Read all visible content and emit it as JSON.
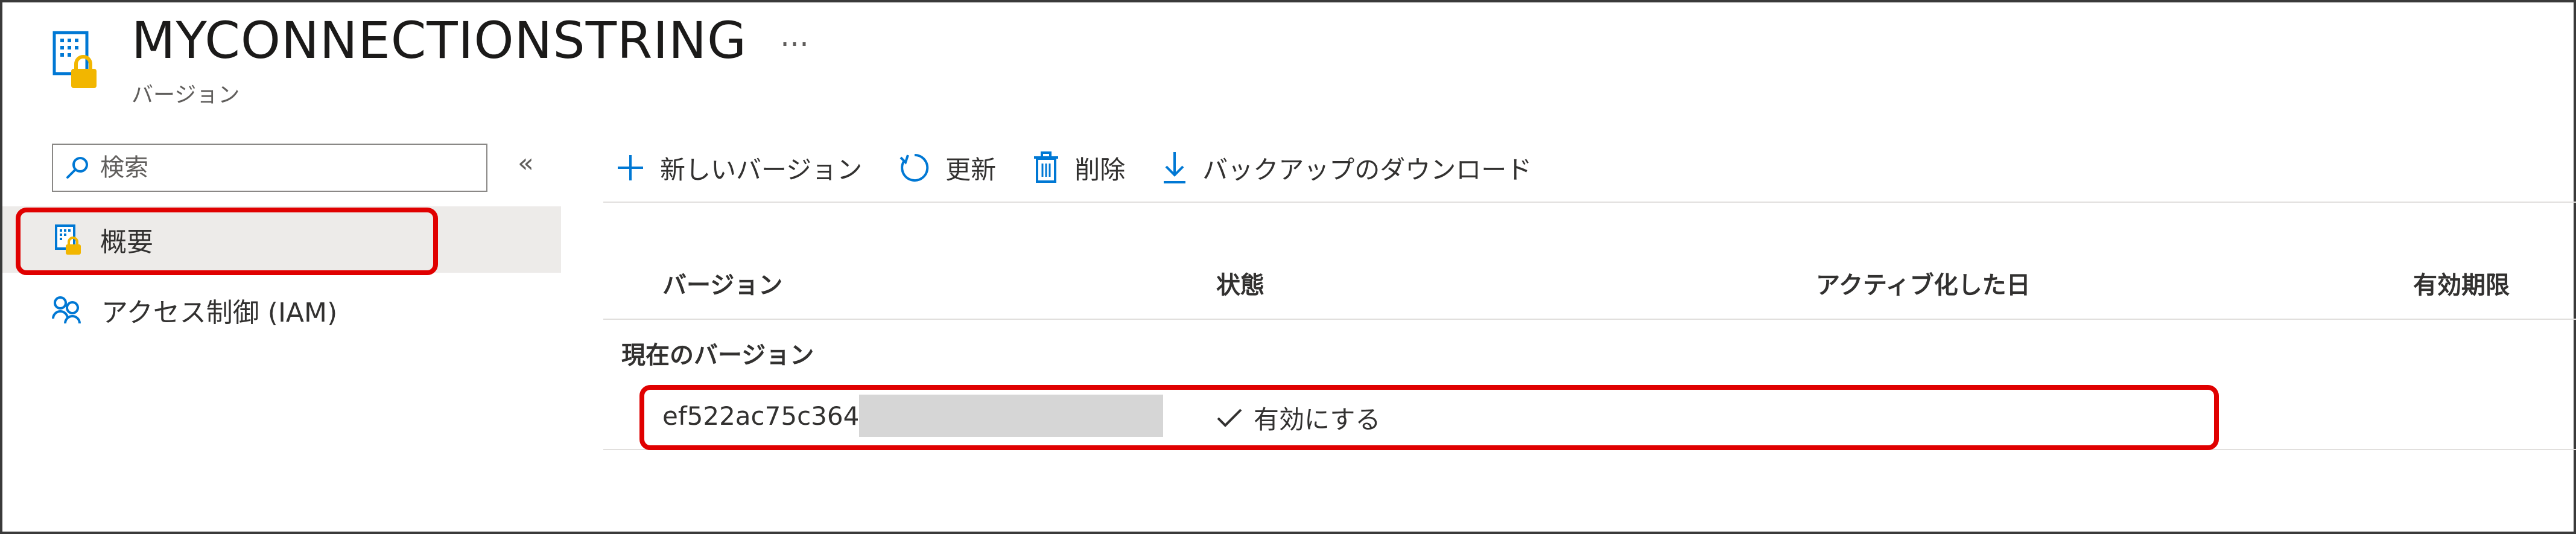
{
  "header": {
    "title": "MYCONNECTIONSTRING",
    "subtitle": "バージョン",
    "more_label": "…"
  },
  "sidebar": {
    "search_placeholder": "検索",
    "collapse_label": "«",
    "items": [
      {
        "label": "概要",
        "icon": "key-vault-secret-icon",
        "active": true
      },
      {
        "label": "アクセス制御 (IAM)",
        "icon": "people-icon",
        "active": false
      }
    ]
  },
  "toolbar": {
    "new_version": "新しいバージョン",
    "refresh": "更新",
    "delete": "削除",
    "download_backup": "バックアップのダウンロード"
  },
  "table": {
    "columns": [
      "バージョン",
      "状態",
      "アクティブ化した日",
      "有効期限"
    ],
    "group_label": "現在のバージョン",
    "rows": [
      {
        "version": "ef522ac75c364",
        "status": "有効にする",
        "activated": "",
        "expires": ""
      }
    ]
  },
  "colors": {
    "accent": "#0078d4",
    "highlight": "#e00000",
    "active_bg": "#edebe9",
    "lock": "#f2b600"
  }
}
